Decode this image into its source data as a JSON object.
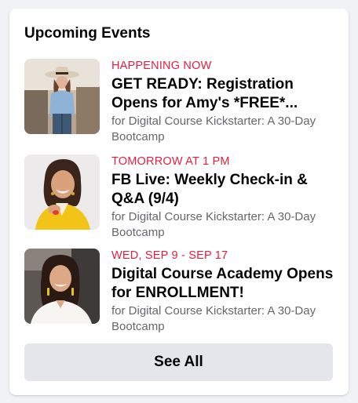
{
  "card": {
    "title": "Upcoming Events"
  },
  "events": [
    {
      "when": "HAPPENING NOW",
      "title": "GET READY: Registration Opens for Amy's *FREE*...",
      "group": "for Digital Course Kickstarter: A 30-Day Bootcamp",
      "thumbnail_icon": "photo-woman-hat"
    },
    {
      "when": "TOMORROW AT 1 PM",
      "title": "FB Live: Weekly Check-in & Q&A (9/4)",
      "group": "for Digital Course Kickstarter: A 30-Day Bootcamp",
      "thumbnail_icon": "photo-woman-yellow"
    },
    {
      "when": "WED, SEP 9 - SEP 17",
      "title": "Digital Course Academy Opens for ENROLLMENT!",
      "group": "for Digital Course Kickstarter: A 30-Day Bootcamp",
      "thumbnail_icon": "photo-woman-white"
    }
  ],
  "footer": {
    "see_all_label": "See All"
  },
  "colors": {
    "accent_date": "#e41e3f",
    "button_bg": "#e4e6eb",
    "secondary_text": "#65676b",
    "page_bg": "#f0f2f5"
  }
}
